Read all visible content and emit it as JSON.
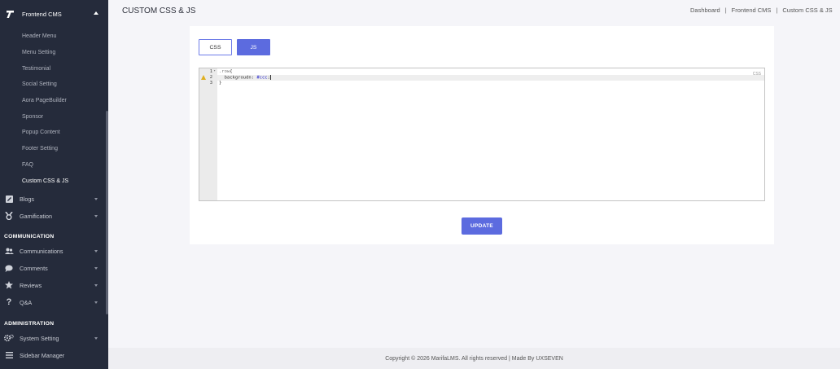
{
  "sidebar": {
    "top": {
      "label": "Frontend CMS",
      "icon": "logo-icon"
    },
    "subitems": [
      {
        "label": "Header Menu"
      },
      {
        "label": "Menu Setting"
      },
      {
        "label": "Testimonial"
      },
      {
        "label": "Social Setting"
      },
      {
        "label": "Aora PageBuilder"
      },
      {
        "label": "Sponsor"
      },
      {
        "label": "Popup Content"
      },
      {
        "label": "Footer Setting"
      },
      {
        "label": "FAQ"
      },
      {
        "label": "Custom CSS & JS"
      }
    ],
    "active_subitem": "Custom CSS & JS",
    "nav_items_1": [
      {
        "label": "Blogs",
        "icon": "edit-icon"
      },
      {
        "label": "Gamification",
        "icon": "medal-icon"
      }
    ],
    "section_communication": "COMMUNICATION",
    "nav_items_2": [
      {
        "label": "Communications",
        "icon": "users-icon"
      },
      {
        "label": "Comments",
        "icon": "comment-icon"
      },
      {
        "label": "Reviews",
        "icon": "star-icon"
      },
      {
        "label": "Q&A",
        "icon": "question-icon"
      }
    ],
    "section_administration": "ADMINISTRATION",
    "nav_items_3": [
      {
        "label": "System Setting",
        "icon": "gears-icon"
      },
      {
        "label": "Sidebar Manager",
        "icon": "menu-icon"
      }
    ]
  },
  "header": {
    "title": "CUSTOM CSS & JS",
    "breadcrumb": [
      "Dashboard",
      "Frontend CMS",
      "Custom CSS & JS"
    ]
  },
  "tabs": [
    {
      "label": "CSS",
      "active": false
    },
    {
      "label": "JS",
      "active": true
    }
  ],
  "editor": {
    "mode": "CSS",
    "lines": [
      {
        "num": "1",
        "selector": ".row",
        "rest": "{"
      },
      {
        "num": "2",
        "prop": "backgroudn",
        "value": "#ccc",
        "warning": true
      },
      {
        "num": "3",
        "text": "}"
      }
    ]
  },
  "update_button": "UPDATE",
  "footer": "Copyright © 2026 MarifaLMS. All rights reserved | Made By UXSEVEN",
  "colors": {
    "sidebar_bg": "#252b3b",
    "primary": "#5c6bdf",
    "page_bg": "#f5f5f9"
  }
}
